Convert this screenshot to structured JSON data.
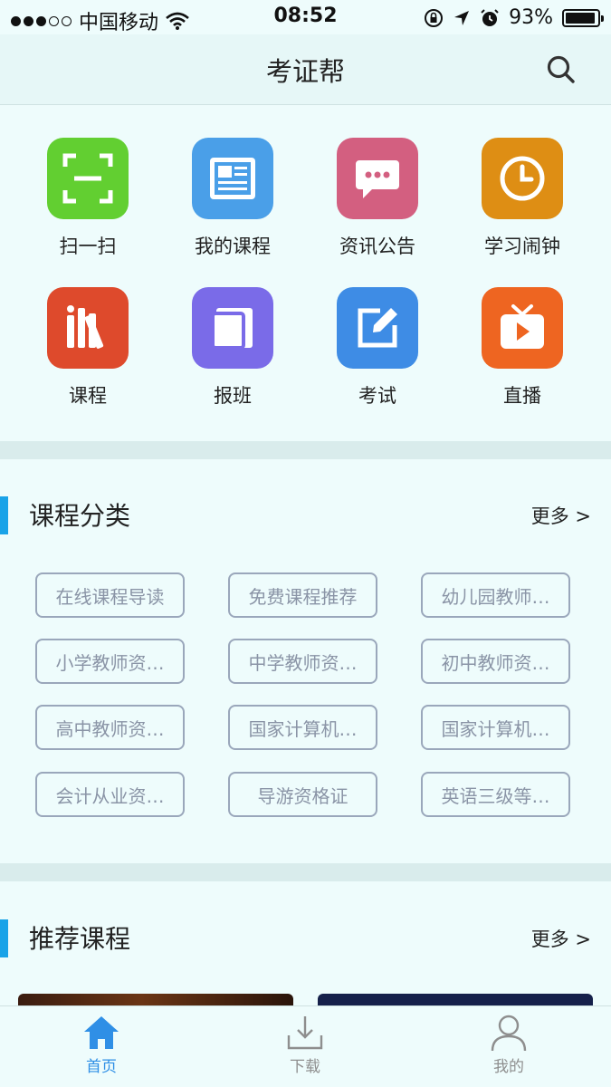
{
  "status": {
    "carrier": "中国移动",
    "time": "08:52",
    "battery": "93%",
    "battery_level": 0.93
  },
  "nav": {
    "title": "考证帮",
    "search_icon": "search-icon"
  },
  "quick_menu": [
    {
      "label": "扫一扫",
      "icon": "scan-icon",
      "color": "#62cf31"
    },
    {
      "label": "我的课程",
      "icon": "news-icon",
      "color": "#4a9fe8"
    },
    {
      "label": "资讯公告",
      "icon": "chat-bubble-icon",
      "color": "#d35f80"
    },
    {
      "label": "学习闹钟",
      "icon": "clock-icon",
      "color": "#de8e14"
    },
    {
      "label": "课程",
      "icon": "books-icon",
      "color": "#de4a2c"
    },
    {
      "label": "报班",
      "icon": "notebook-icon",
      "color": "#7a6be8"
    },
    {
      "label": "考试",
      "icon": "edit-icon",
      "color": "#3e8ce5"
    },
    {
      "label": "直播",
      "icon": "tv-icon",
      "color": "#ee6521"
    }
  ],
  "categories": {
    "title": "课程分类",
    "more": "更多 >",
    "tags": [
      "在线课程导读",
      "免费课程推荐",
      "幼儿园教师…",
      "小学教师资…",
      "中学教师资…",
      "初中教师资…",
      "高中教师资…",
      "国家计算机…",
      "国家计算机…",
      "会计从业资…",
      "导游资格证",
      "英语三级等…"
    ]
  },
  "recommend": {
    "title": "推荐课程",
    "more": "更多 >"
  },
  "tabbar": {
    "active_color": "#2f8fe6",
    "inactive_color": "#8e8e8e",
    "tabs": [
      {
        "label": "首页",
        "icon": "home-icon",
        "active": true
      },
      {
        "label": "下载",
        "icon": "download-icon",
        "active": false
      },
      {
        "label": "我的",
        "icon": "user-icon",
        "active": false
      }
    ]
  }
}
